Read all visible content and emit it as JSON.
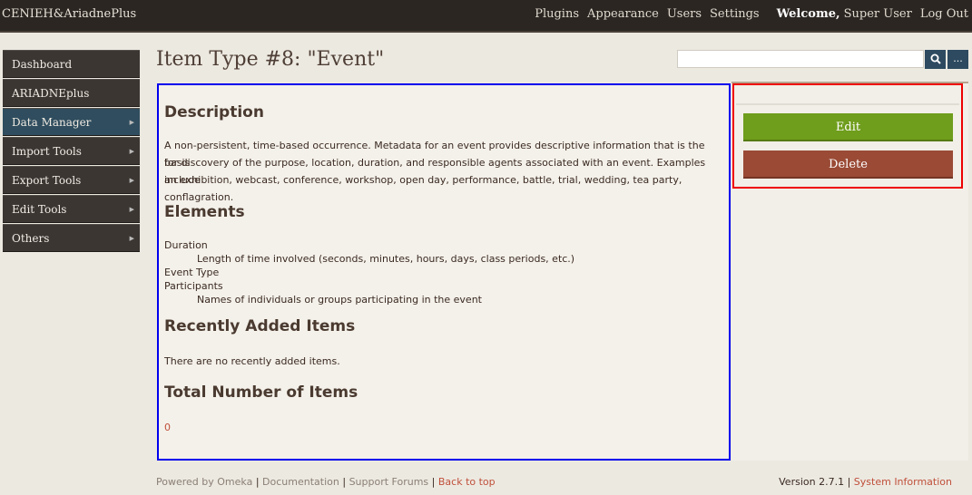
{
  "topbar": {
    "site_title": "CENIEH&AriadnePlus",
    "nav": [
      "Plugins",
      "Appearance",
      "Users",
      "Settings"
    ],
    "welcome_label": "Welcome,",
    "user_name": "Super User",
    "logout": "Log Out"
  },
  "sidebar": {
    "items": [
      {
        "label": "Dashboard",
        "has_arrow": false
      },
      {
        "label": "ARIADNEplus Tracking",
        "has_arrow": false
      },
      {
        "label": "Data Manager",
        "has_arrow": true
      },
      {
        "label": "Import Tools",
        "has_arrow": true
      },
      {
        "label": "Export Tools",
        "has_arrow": true
      },
      {
        "label": "Edit Tools",
        "has_arrow": true
      },
      {
        "label": "Others",
        "has_arrow": true
      }
    ]
  },
  "page": {
    "title": "Item Type #8: \"Event\""
  },
  "search": {
    "value": "",
    "advanced_label": "..."
  },
  "main": {
    "description_heading": "Description",
    "description_lines": [
      "A non-persistent, time-based occurrence. Metadata for an event provides descriptive information that is the basis",
      "for discovery of the purpose, location, duration, and responsible agents associated with an event. Examples include",
      "an exhibition, webcast, conference, workshop, open day, performance, battle, trial, wedding, tea party, conflagration."
    ],
    "elements_heading": "Elements",
    "elements": [
      {
        "name": "Duration",
        "description": "Length of time involved (seconds, minutes, hours, days, class periods, etc.)"
      },
      {
        "name": "Event Type",
        "description": ""
      },
      {
        "name": "Participants",
        "description": "Names of individuals or groups participating in the event"
      }
    ],
    "recent_heading": "Recently Added Items",
    "recent_text": "There are no recently added items.",
    "total_heading": "Total Number of Items",
    "total_value": "0"
  },
  "actions": {
    "edit": "Edit",
    "delete": "Delete"
  },
  "footer": {
    "powered": "Powered by Omeka",
    "documentation": "Documentation",
    "forums": "Support Forums",
    "back_to_top": "Back to top",
    "version": "Version 2.7.1",
    "system_info": "System Information"
  },
  "colors": {
    "topbar": "#2b2622",
    "edit_button": "#6f9d1c",
    "delete_button": "#9a4a35",
    "link": "#c0503a",
    "sidebar_active": "#2f4d5e"
  }
}
